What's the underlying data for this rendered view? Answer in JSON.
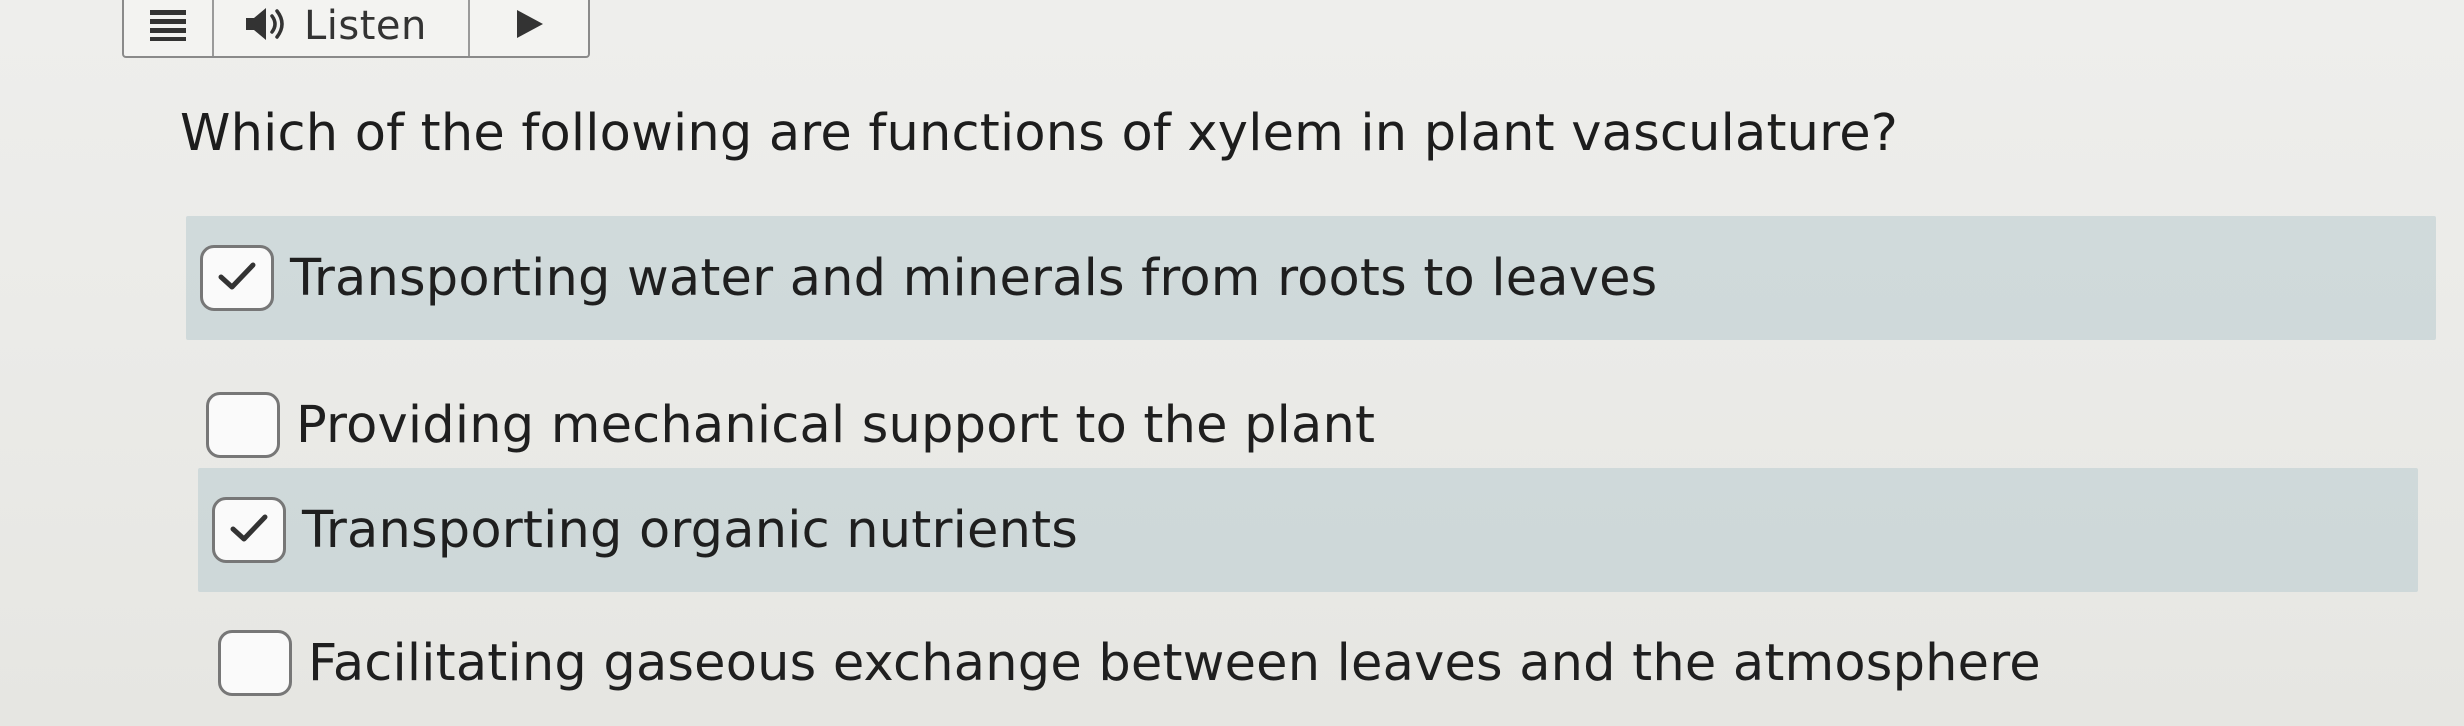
{
  "toolbar": {
    "menu_icon": "hamburger-menu-icon",
    "listen_icon": "speaker-icon",
    "listen_label": "Listen",
    "play_icon": "play-icon"
  },
  "question": {
    "text": "Which of the following are functions of xylem in plant vasculature?"
  },
  "options": [
    {
      "label": "Transporting water and minerals from roots to leaves",
      "checked": true
    },
    {
      "label": "Providing mechanical support to the plant",
      "checked": false
    },
    {
      "label": "Transporting organic nutrients",
      "checked": true
    },
    {
      "label": "Facilitating gaseous exchange between leaves and the atmosphere",
      "checked": false
    }
  ],
  "colors": {
    "shaded_row": "#bfcfd3",
    "checkbox_border": "#777777",
    "text": "#1f1f1f"
  }
}
